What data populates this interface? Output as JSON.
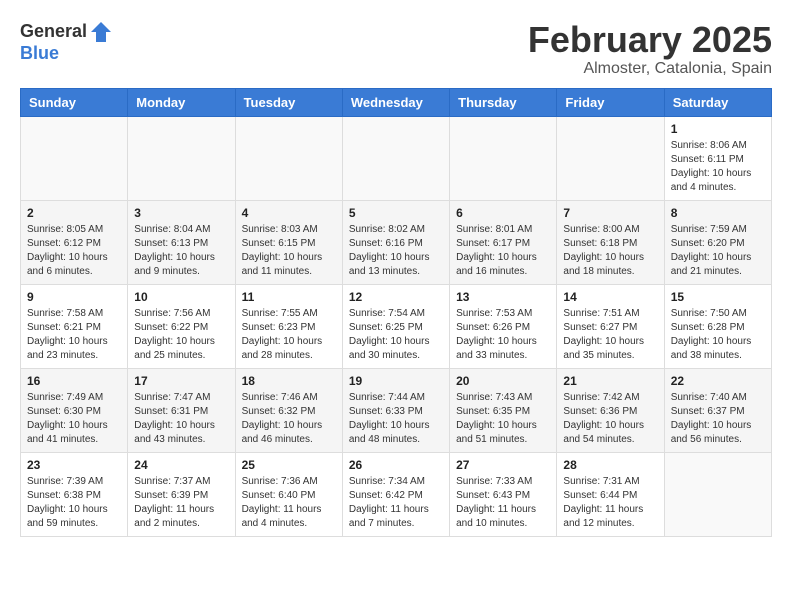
{
  "logo": {
    "general": "General",
    "blue": "Blue"
  },
  "title": {
    "month": "February 2025",
    "location": "Almoster, Catalonia, Spain"
  },
  "weekdays": [
    "Sunday",
    "Monday",
    "Tuesday",
    "Wednesday",
    "Thursday",
    "Friday",
    "Saturday"
  ],
  "weeks": [
    [
      {
        "day": "",
        "info": ""
      },
      {
        "day": "",
        "info": ""
      },
      {
        "day": "",
        "info": ""
      },
      {
        "day": "",
        "info": ""
      },
      {
        "day": "",
        "info": ""
      },
      {
        "day": "",
        "info": ""
      },
      {
        "day": "1",
        "info": "Sunrise: 8:06 AM\nSunset: 6:11 PM\nDaylight: 10 hours and 4 minutes."
      }
    ],
    [
      {
        "day": "2",
        "info": "Sunrise: 8:05 AM\nSunset: 6:12 PM\nDaylight: 10 hours and 6 minutes."
      },
      {
        "day": "3",
        "info": "Sunrise: 8:04 AM\nSunset: 6:13 PM\nDaylight: 10 hours and 9 minutes."
      },
      {
        "day": "4",
        "info": "Sunrise: 8:03 AM\nSunset: 6:15 PM\nDaylight: 10 hours and 11 minutes."
      },
      {
        "day": "5",
        "info": "Sunrise: 8:02 AM\nSunset: 6:16 PM\nDaylight: 10 hours and 13 minutes."
      },
      {
        "day": "6",
        "info": "Sunrise: 8:01 AM\nSunset: 6:17 PM\nDaylight: 10 hours and 16 minutes."
      },
      {
        "day": "7",
        "info": "Sunrise: 8:00 AM\nSunset: 6:18 PM\nDaylight: 10 hours and 18 minutes."
      },
      {
        "day": "8",
        "info": "Sunrise: 7:59 AM\nSunset: 6:20 PM\nDaylight: 10 hours and 21 minutes."
      }
    ],
    [
      {
        "day": "9",
        "info": "Sunrise: 7:58 AM\nSunset: 6:21 PM\nDaylight: 10 hours and 23 minutes."
      },
      {
        "day": "10",
        "info": "Sunrise: 7:56 AM\nSunset: 6:22 PM\nDaylight: 10 hours and 25 minutes."
      },
      {
        "day": "11",
        "info": "Sunrise: 7:55 AM\nSunset: 6:23 PM\nDaylight: 10 hours and 28 minutes."
      },
      {
        "day": "12",
        "info": "Sunrise: 7:54 AM\nSunset: 6:25 PM\nDaylight: 10 hours and 30 minutes."
      },
      {
        "day": "13",
        "info": "Sunrise: 7:53 AM\nSunset: 6:26 PM\nDaylight: 10 hours and 33 minutes."
      },
      {
        "day": "14",
        "info": "Sunrise: 7:51 AM\nSunset: 6:27 PM\nDaylight: 10 hours and 35 minutes."
      },
      {
        "day": "15",
        "info": "Sunrise: 7:50 AM\nSunset: 6:28 PM\nDaylight: 10 hours and 38 minutes."
      }
    ],
    [
      {
        "day": "16",
        "info": "Sunrise: 7:49 AM\nSunset: 6:30 PM\nDaylight: 10 hours and 41 minutes."
      },
      {
        "day": "17",
        "info": "Sunrise: 7:47 AM\nSunset: 6:31 PM\nDaylight: 10 hours and 43 minutes."
      },
      {
        "day": "18",
        "info": "Sunrise: 7:46 AM\nSunset: 6:32 PM\nDaylight: 10 hours and 46 minutes."
      },
      {
        "day": "19",
        "info": "Sunrise: 7:44 AM\nSunset: 6:33 PM\nDaylight: 10 hours and 48 minutes."
      },
      {
        "day": "20",
        "info": "Sunrise: 7:43 AM\nSunset: 6:35 PM\nDaylight: 10 hours and 51 minutes."
      },
      {
        "day": "21",
        "info": "Sunrise: 7:42 AM\nSunset: 6:36 PM\nDaylight: 10 hours and 54 minutes."
      },
      {
        "day": "22",
        "info": "Sunrise: 7:40 AM\nSunset: 6:37 PM\nDaylight: 10 hours and 56 minutes."
      }
    ],
    [
      {
        "day": "23",
        "info": "Sunrise: 7:39 AM\nSunset: 6:38 PM\nDaylight: 10 hours and 59 minutes."
      },
      {
        "day": "24",
        "info": "Sunrise: 7:37 AM\nSunset: 6:39 PM\nDaylight: 11 hours and 2 minutes."
      },
      {
        "day": "25",
        "info": "Sunrise: 7:36 AM\nSunset: 6:40 PM\nDaylight: 11 hours and 4 minutes."
      },
      {
        "day": "26",
        "info": "Sunrise: 7:34 AM\nSunset: 6:42 PM\nDaylight: 11 hours and 7 minutes."
      },
      {
        "day": "27",
        "info": "Sunrise: 7:33 AM\nSunset: 6:43 PM\nDaylight: 11 hours and 10 minutes."
      },
      {
        "day": "28",
        "info": "Sunrise: 7:31 AM\nSunset: 6:44 PM\nDaylight: 11 hours and 12 minutes."
      },
      {
        "day": "",
        "info": ""
      }
    ]
  ]
}
